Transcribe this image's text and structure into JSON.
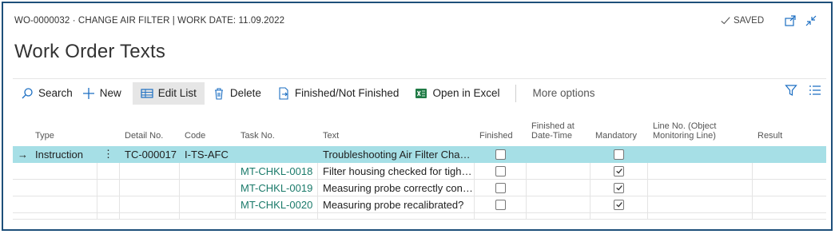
{
  "header": {
    "caption": "WO-0000032 · CHANGE AIR FILTER | WORK DATE: 11.09.2022",
    "saved": "SAVED",
    "title": "Work Order Texts"
  },
  "toolbar": {
    "search": "Search",
    "new": "New",
    "edit_list": "Edit List",
    "delete": "Delete",
    "finished_toggle": "Finished/Not Finished",
    "open_excel": "Open in Excel",
    "more": "More options"
  },
  "columns": {
    "type": "Type",
    "detail_no": "Detail No.",
    "code": "Code",
    "task_no": "Task No.",
    "text": "Text",
    "finished": "Finished",
    "finished_at": "Finished at Date-Time",
    "mandatory": "Mandatory",
    "line_no": "Line No. (Object Monitoring Line)",
    "result": "Result"
  },
  "rows": [
    {
      "arrow": "→",
      "type": "Instruction",
      "dots": "⋮",
      "detail_no": "TC-000017",
      "code": "I-TS-AFC",
      "task_no": "",
      "text": "Troubleshooting Air Filter Change",
      "finished": false,
      "mandatory": false
    },
    {
      "arrow": "",
      "type": "",
      "dots": "",
      "detail_no": "",
      "code": "",
      "task_no": "MT-CHKL-0018",
      "text": "Filter housing checked for tight ...",
      "finished": false,
      "mandatory": true
    },
    {
      "arrow": "",
      "type": "",
      "dots": "",
      "detail_no": "",
      "code": "",
      "task_no": "MT-CHKL-0019",
      "text": "Measuring probe correctly conn...",
      "finished": false,
      "mandatory": true
    },
    {
      "arrow": "",
      "type": "",
      "dots": "",
      "detail_no": "",
      "code": "",
      "task_no": "MT-CHKL-0020",
      "text": "Measuring probe recalibrated?",
      "finished": false,
      "mandatory": true
    }
  ],
  "colors": {
    "selected_row": "#a6dfe6",
    "link": "#1a7a6a",
    "accent": "#1b6ec2",
    "frame": "#1e4f7a"
  }
}
